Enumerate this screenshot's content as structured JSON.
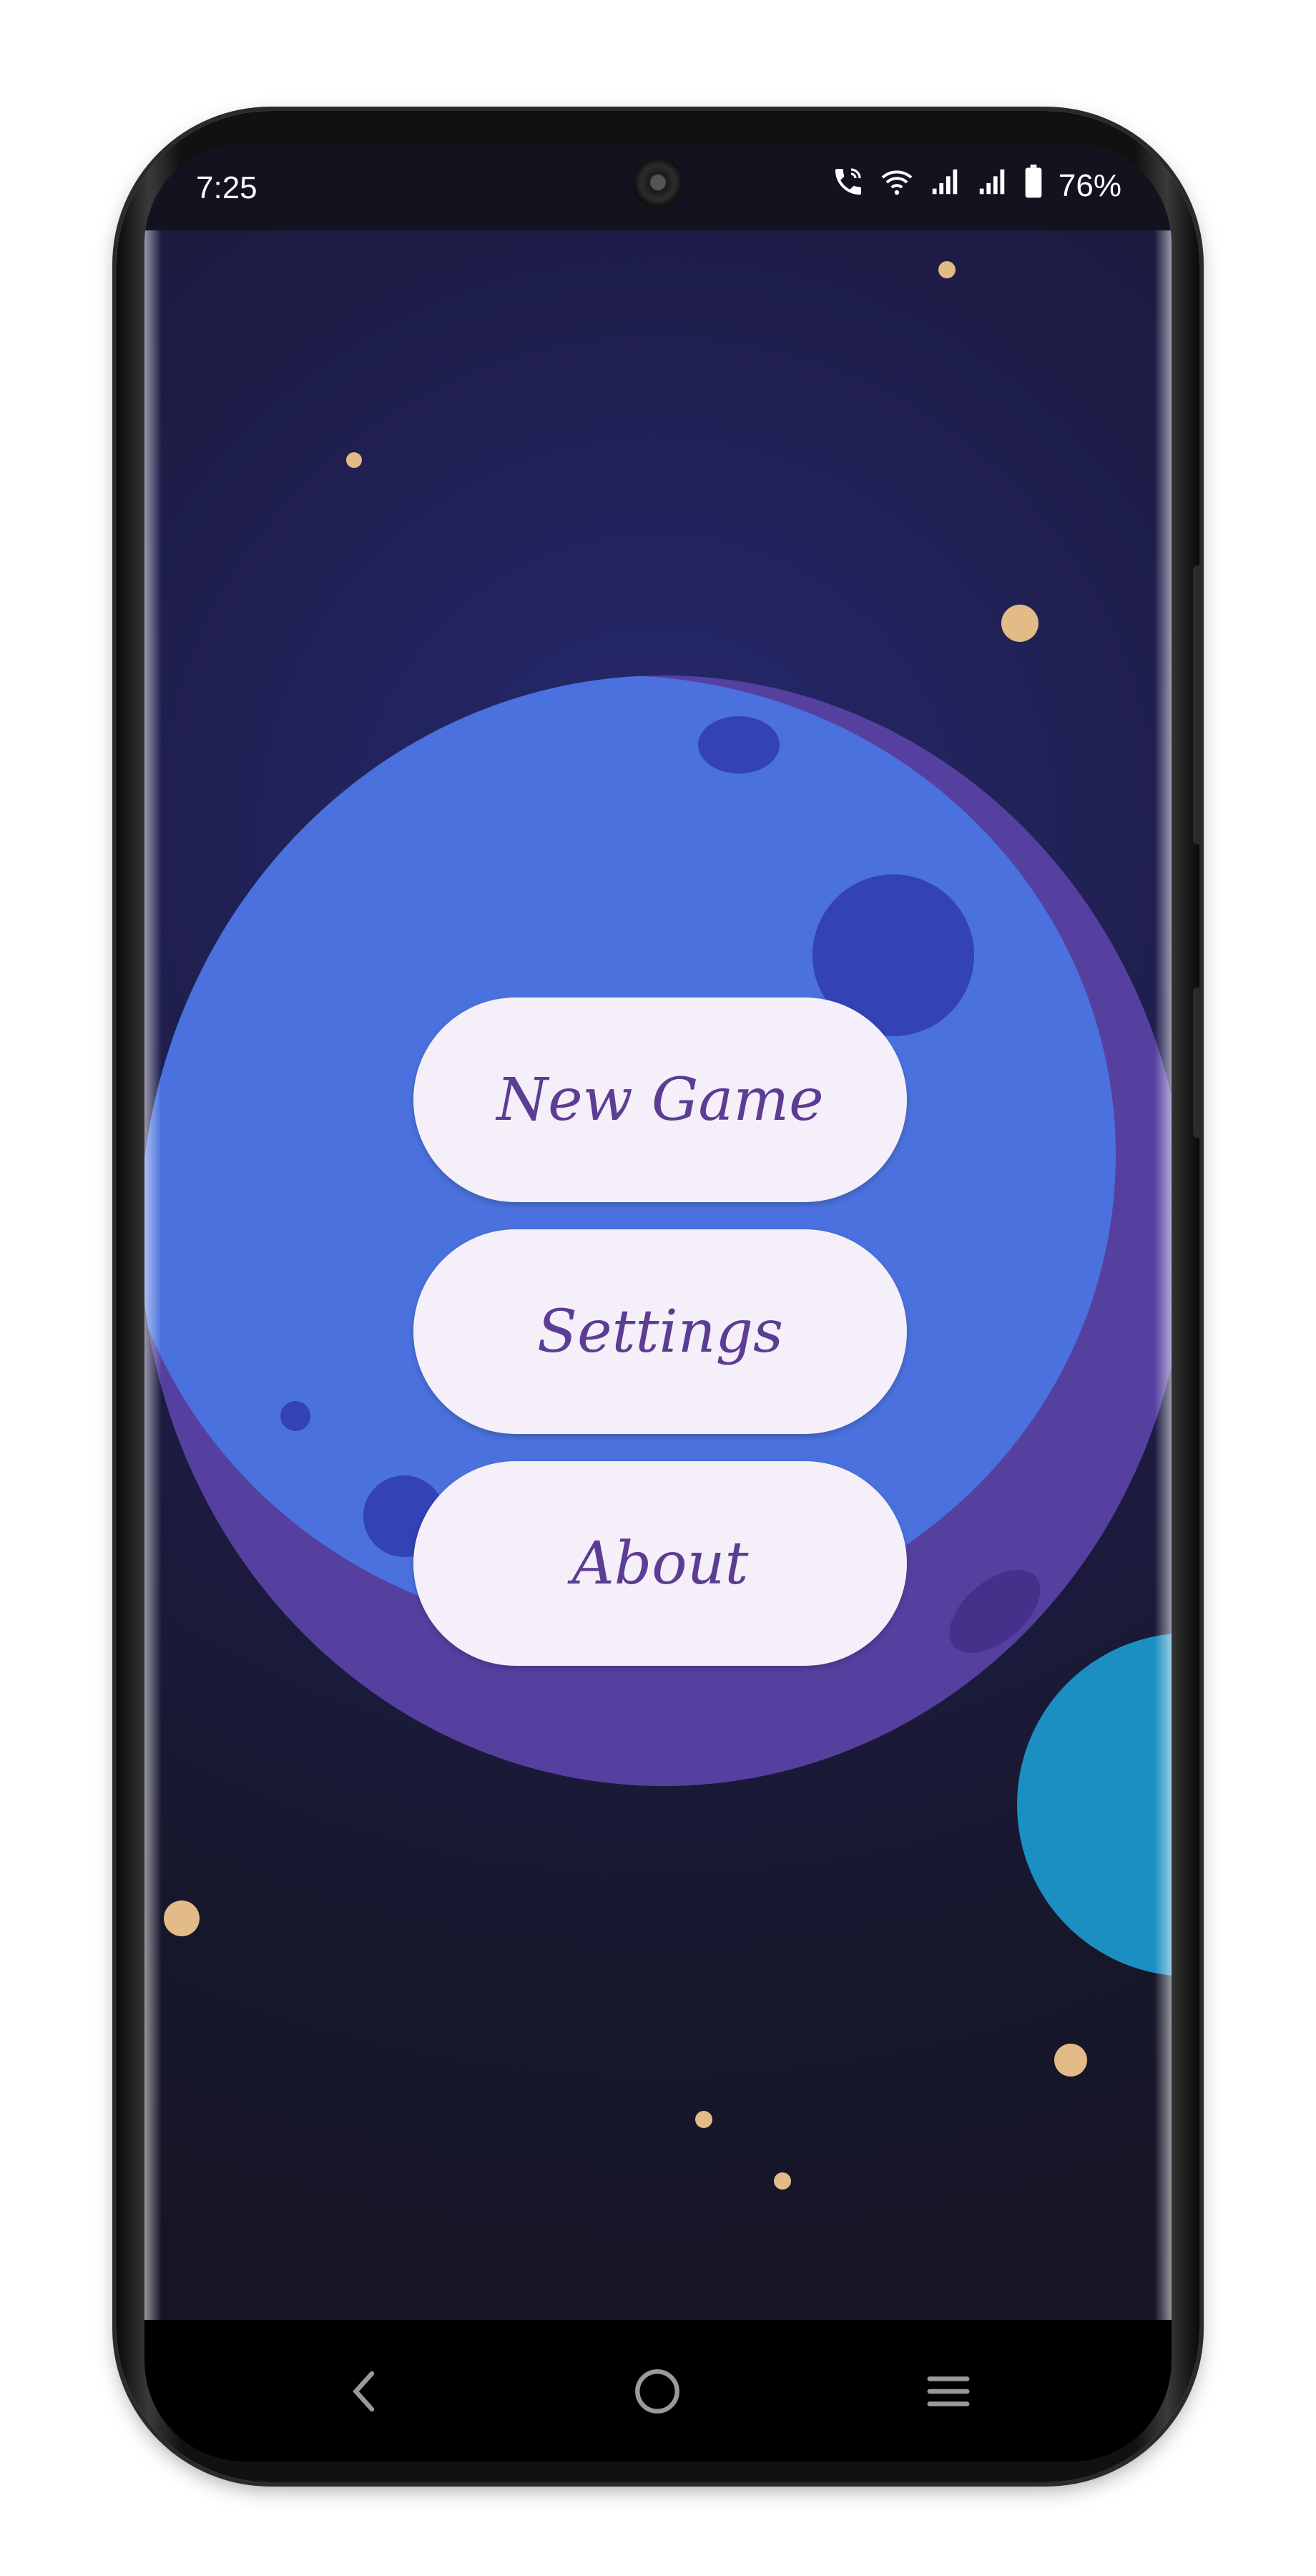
{
  "status_bar": {
    "time": "7:25",
    "battery": "76%",
    "icons": [
      "wifi-calling-icon",
      "wifi-icon",
      "signal-icon",
      "signal-icon",
      "battery-icon"
    ]
  },
  "menu": {
    "new_game": "New Game",
    "settings": "Settings",
    "about": "About"
  },
  "nav_bar": {
    "icons": [
      "back-icon",
      "home-icon",
      "recents-icon"
    ]
  },
  "colors": {
    "background": "#17172b",
    "planet": "#4a71dd",
    "planet_shadow": "#5540a0",
    "button_bg": "#f4eff8",
    "button_text": "#5c3d94",
    "star": "#e2bb86"
  }
}
